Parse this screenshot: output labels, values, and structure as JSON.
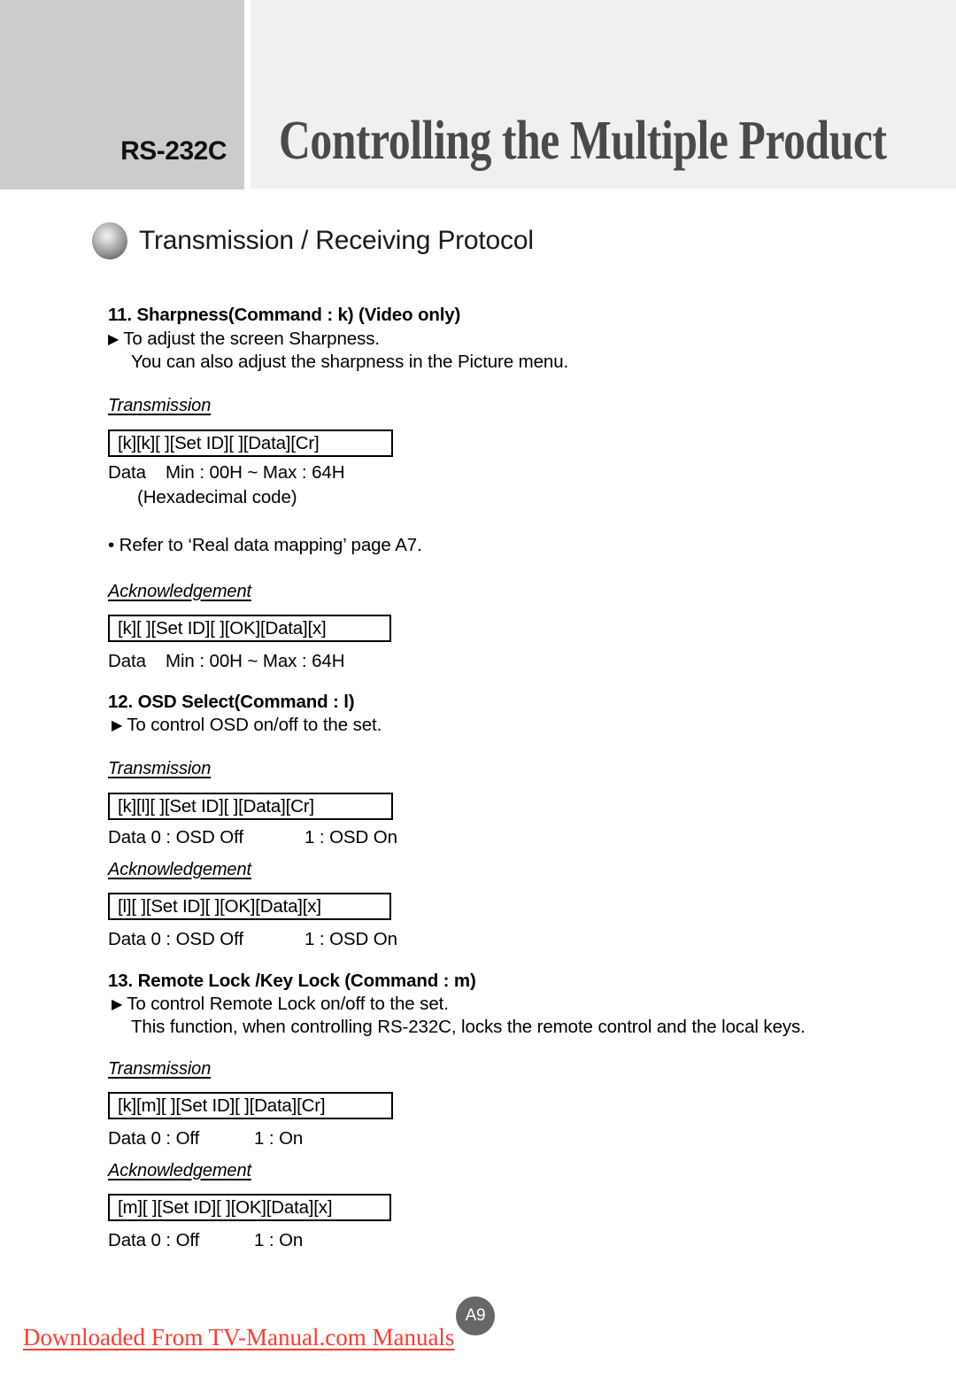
{
  "header": {
    "kicker": "RS-232C",
    "title": "Controlling the Multiple Product"
  },
  "protocol_heading": {
    "bullet_icon": "sphere-bullet-icon",
    "label": "Transmission / Receiving Protocol"
  },
  "sections": [
    {
      "number_title": "11. Sharpness(Command : k) (Video only)",
      "bullet_icon": "triangle-right-icon",
      "bullet_text": "To adjust the screen Sharpness.",
      "continuation": "You can also adjust the sharpness in the Picture menu.",
      "transmission_label": "Transmission",
      "transmission_box": "[k][k][ ][Set ID][ ][Data][Cr]",
      "transmission_data_a": "Data",
      "transmission_data_b": "Min : 00H ~ Max : 64H",
      "transmission_data_c": "(Hexadecimal code)",
      "note": "• Refer to ‘Real data mapping’ page A7.",
      "ack_label": "Acknowledgement",
      "ack_box": "[k][ ][Set ID][ ][OK][Data][x]",
      "ack_data_a": "Data",
      "ack_data_b": "Min : 00H ~ Max : 64H"
    },
    {
      "number_title": "12. OSD Select(Command : l)",
      "bullet_icon": "triangle-right-icon",
      "bullet_text": "To control OSD on/off to the set.",
      "transmission_label": "Transmission",
      "transmission_box": "[k][l][ ][Set ID][ ][Data][Cr]",
      "transmission_data_a": "Data 0 : OSD Off",
      "transmission_data_b": "1 : OSD On",
      "ack_label": "Acknowledgement",
      "ack_box": "[l][ ][Set ID][ ][OK][Data][x]",
      "ack_data_a": "Data 0 : OSD Off",
      "ack_data_b": "1 : OSD On"
    },
    {
      "number_title": "13. Remote Lock /Key Lock (Command : m)",
      "bullet_icon": "triangle-right-icon",
      "bullet_text": "To control Remote Lock on/off to the set.",
      "continuation": "This function, when controlling RS-232C, locks the remote control and the local keys.",
      "transmission_label": "Transmission",
      "transmission_box": "[k][m][ ][Set ID][ ][Data][Cr]",
      "transmission_data_a": "Data 0 : Off",
      "transmission_data_b": "1 : On",
      "ack_label": "Acknowledgement",
      "ack_box": "[m][ ][Set ID][ ][OK][Data][x]",
      "ack_data_a": "Data 0 : Off",
      "ack_data_b": "1 : On"
    }
  ],
  "footer": {
    "page_badge": "A9",
    "note": "Downloaded From TV-Manual.com Manuals"
  },
  "colors": {
    "header_left_block": "#cccccc",
    "header_right_block": "#f0f0f0",
    "header_title": "#4a4a4a",
    "page_badge_bg": "#676767",
    "footer_note": "#ff3b30"
  },
  "triangle_glyph": "▶"
}
